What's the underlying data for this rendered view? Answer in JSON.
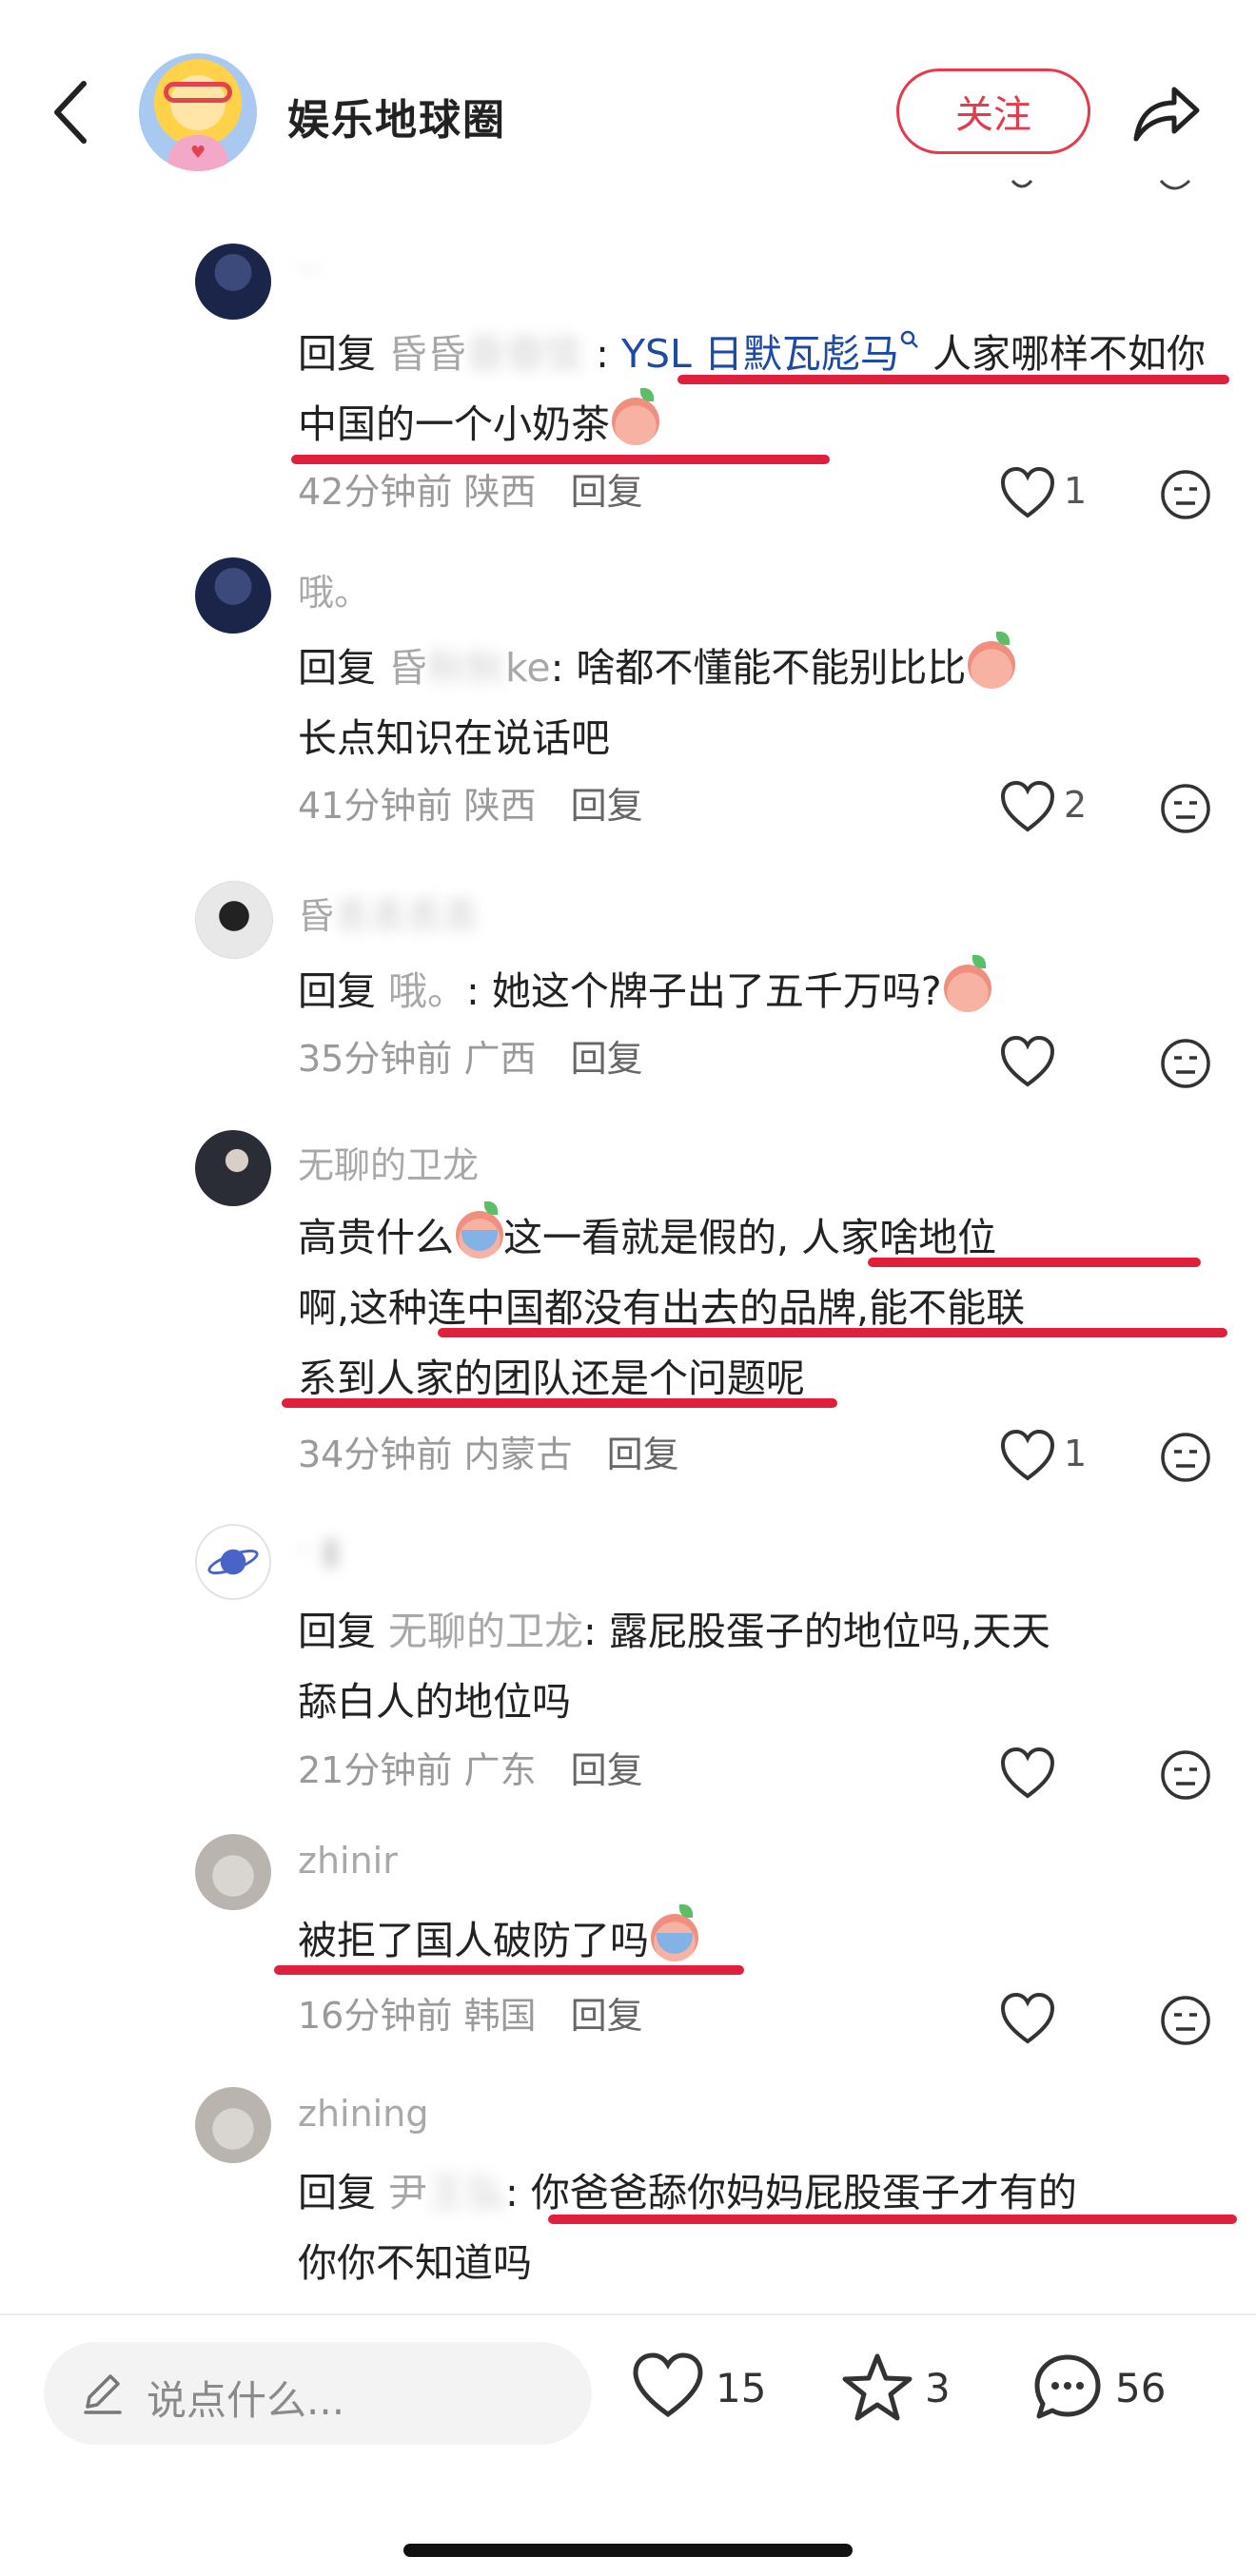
{
  "header": {
    "title": "娱乐地球圈",
    "follow_label": "关注"
  },
  "comments": [
    {
      "name": "",
      "reply_prefix": "回复",
      "reply_to": "昏昏",
      "colon": ":",
      "link_text": "YSL 日默瓦彪马",
      "text_after_link": "人家哪样不如你中国的一个小奶茶",
      "time": "42分钟前",
      "location": "陕西",
      "reply_label": "回复",
      "likes": "1"
    },
    {
      "name": "哦。",
      "reply_prefix": "回复",
      "reply_to": "昏",
      "reply_to_tail": "ke",
      "text": ": 啥都不懂能不能别比比",
      "text_line2": "长点知识在说话吧",
      "time": "41分钟前",
      "location": "陕西",
      "reply_label": "回复",
      "likes": "2"
    },
    {
      "name": "昏",
      "reply_prefix": "回复",
      "reply_to": "哦。",
      "text": ": 她这个牌子出了五千万吗?",
      "time": "35分钟前",
      "location": "广西",
      "reply_label": "回复",
      "likes": ""
    },
    {
      "name": "无聊的卫龙",
      "text_a": "高贵什么",
      "text_b": "这一看就是假的,",
      "text_c": "人家啥地位",
      "text_line2": "啊,这种连中国都没有出去的品牌,能不能联",
      "text_line3": "系到人家的团队还是个问题呢",
      "time": "34分钟前",
      "location": "内蒙古",
      "reply_label": "回复",
      "likes": "1"
    },
    {
      "name": "",
      "reply_prefix": "回复",
      "reply_to": "无聊的卫龙",
      "text": ": 露屁股蛋子的地位吗,天天",
      "text_line2": "舔白人的地位吗",
      "time": "21分钟前",
      "location": "广东",
      "reply_label": "回复",
      "likes": ""
    },
    {
      "name": "zhinir",
      "text": "被拒了国人破防了吗",
      "time": "16分钟前",
      "location": "韩国",
      "reply_label": "回复",
      "likes": ""
    },
    {
      "name": "zhining",
      "reply_prefix": "回复",
      "reply_to": "尹",
      "text": ": 你爸爸舔你妈妈屁股蛋子才有的",
      "text_line2": "你你不知道吗"
    }
  ],
  "bottom": {
    "placeholder": "说点什么...",
    "likes": "15",
    "favorites": "3",
    "comments": "56"
  },
  "colors": {
    "accent": "#e33b4b",
    "underline": "#e01f3d",
    "link": "#1d4aa3"
  }
}
